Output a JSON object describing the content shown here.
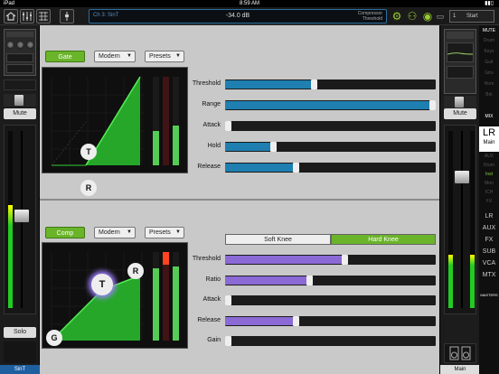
{
  "status_bar": {
    "carrier": "iPad",
    "time": "8:59 AM"
  },
  "toolbar": {
    "channel_name": "Ch 3: SinT",
    "channel_level": "-34.0 dB",
    "processor_label_1": "Compressor",
    "processor_label_2": "Threshold",
    "scene_number": "1",
    "scene_label": "Start"
  },
  "left_strip": {
    "mute_label": "Mute",
    "solo_label": "Solo",
    "channel_label": "SinT",
    "fader_level": 0.52,
    "meter_level": 0.58
  },
  "gate": {
    "button_label": "Gate",
    "mode_label": "Modern",
    "presets_label": "Presets",
    "params": [
      {
        "label": "Threshold",
        "value": 0.42,
        "color": "#1e7fb0"
      },
      {
        "label": "Range",
        "value": 1.0,
        "color": "#1e7fb0"
      },
      {
        "label": "Attack",
        "value": 0.0,
        "color": "#1e7fb0"
      },
      {
        "label": "Hold",
        "value": 0.22,
        "color": "#1e7fb0"
      },
      {
        "label": "Release",
        "value": 0.33,
        "color": "#1e7fb0"
      }
    ],
    "threshold_handle": "T",
    "range_handle": "R"
  },
  "comp": {
    "button_label": "Comp",
    "mode_label": "Modern",
    "presets_label": "Presets",
    "soft_knee_label": "Soft Knee",
    "hard_knee_label": "Hard Knee",
    "params": [
      {
        "label": "Threshold",
        "value": 0.57,
        "color": "#8b6ad6"
      },
      {
        "label": "Ratio",
        "value": 0.4,
        "color": "#8b6ad6"
      },
      {
        "label": "Attack",
        "value": 0.0,
        "color": "#8b6ad6"
      },
      {
        "label": "Release",
        "value": 0.33,
        "color": "#8b6ad6"
      },
      {
        "label": "Gain",
        "value": 0.0,
        "color": "#8b6ad6"
      }
    ],
    "threshold_handle": "T",
    "ratio_handle": "R",
    "gain_handle": "G"
  },
  "right_strip": {
    "mute_label": "Mute",
    "main_label": "Main",
    "fader_level": 0.76
  },
  "mix_column": {
    "mute_header": "MUTE",
    "mute_items": [
      "Drum",
      "Keys",
      "Guit",
      "Gtrs",
      "Horn",
      "Brk"
    ],
    "mix_header": "MIX",
    "lr_label": "LR",
    "lr_sub": "Main",
    "inst_items": [
      "AUX",
      "Drum",
      "Inst",
      "Mon",
      "ICH",
      "FX"
    ],
    "bus_items": [
      "LR",
      "AUX",
      "FX",
      "SUB",
      "VCA",
      "MTX"
    ],
    "masters_label": "MASTERS"
  }
}
